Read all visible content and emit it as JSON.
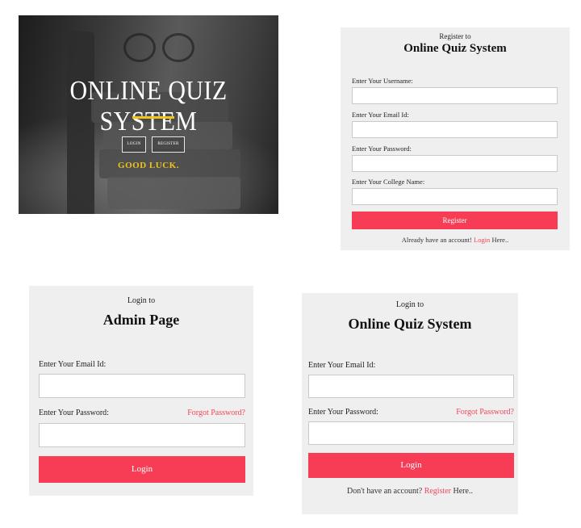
{
  "hero": {
    "title": "ONLINE QUIZ SYSTEM",
    "login_label": "LOGIN",
    "register_label": "REGISTER",
    "tagline": "GOOD LUCK.",
    "accent_color": "#f0c419"
  },
  "register_panel": {
    "subtitle": "Register to",
    "title": "Online Quiz System",
    "username_label": "Enter Your Username:",
    "email_label": "Enter Your Email Id:",
    "password_label": "Enter Your Password:",
    "college_label": "Enter Your College Name:",
    "submit_label": "Register",
    "footer_text": "Already have an account!",
    "footer_link": "Login",
    "footer_suffix": "Here.."
  },
  "admin_panel": {
    "subtitle": "Login to",
    "title": "Admin Page",
    "email_label": "Enter Your Email Id:",
    "password_label": "Enter Your Password:",
    "forgot_label": "Forgot Password?",
    "submit_label": "Login"
  },
  "login_panel": {
    "subtitle": "Login to",
    "title": "Online Quiz System",
    "email_label": "Enter Your Email Id:",
    "password_label": "Enter Your Password:",
    "forgot_label": "Forgot Password?",
    "submit_label": "Login",
    "footer_text": "Don't have an account?",
    "footer_link": "Register",
    "footer_suffix": "Here.."
  },
  "colors": {
    "button": "#f73d55",
    "panel_bg": "#efefef",
    "link": "#f0475a"
  }
}
